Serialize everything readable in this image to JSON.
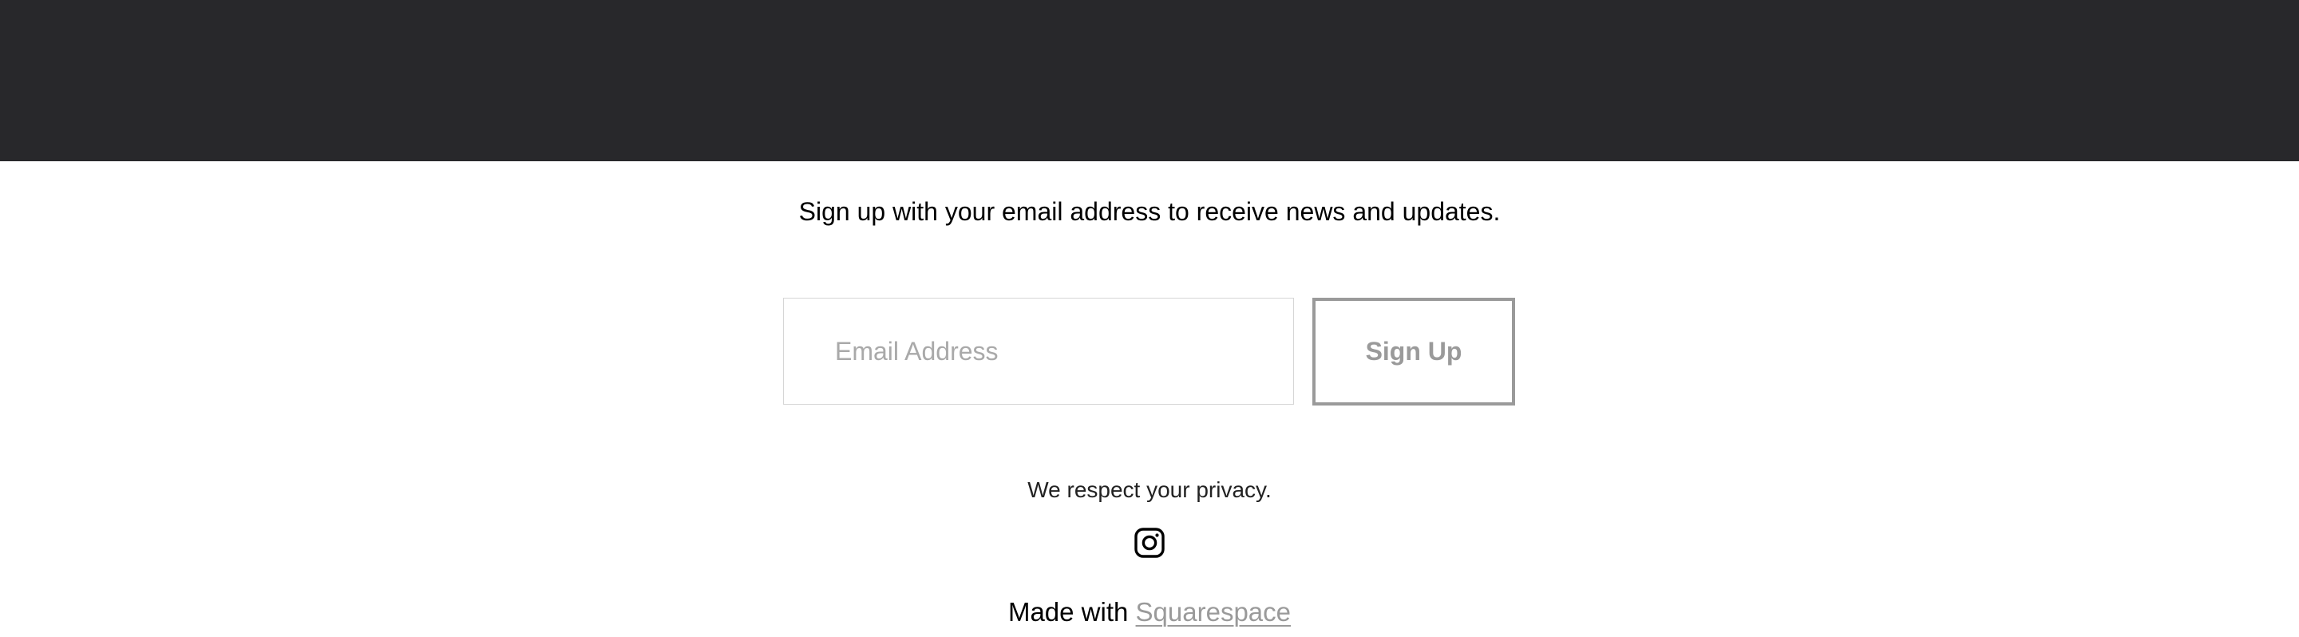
{
  "newsletter": {
    "description": "Sign up with your email address to receive news and updates.",
    "email_placeholder": "Email Address",
    "email_value": "",
    "signup_label": "Sign Up",
    "privacy_text": "We respect your privacy."
  },
  "social": {
    "icon": "instagram-icon"
  },
  "footer": {
    "made_with_text": "Made with",
    "brand_link": "Squarespace"
  },
  "colors": {
    "header_background": "#28282b",
    "button_border": "#9a9a9a",
    "link_color": "#9a9a9a"
  }
}
